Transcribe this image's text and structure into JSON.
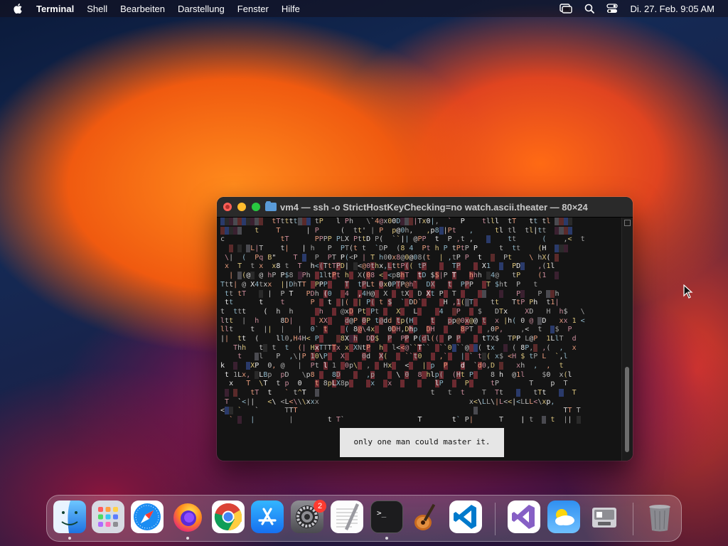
{
  "menubar": {
    "app_name": "Terminal",
    "menus": [
      "Shell",
      "Bearbeiten",
      "Darstellung",
      "Fenster",
      "Hilfe"
    ],
    "clock": "Di. 27. Feb.  9:05 AM"
  },
  "terminal": {
    "title": "vm4 — ssh -o StrictHostKeyChecking=no watch.ascii.theater — 80×24",
    "subtitle": "only one man could master it.",
    "ascii_lines": [
      "▒▒▒▒▒▒▒▒▒▒  tTtttt▒▒▒ tP   l Ph   \\`4@x00D▒▒▒|Tx0|,  `  P    tlll  tT   tt tl ▒▒▒▒",
      "▒▒▒▒▒   t    T      | P     (  tt' | P  p@0h,   ,p8▒|Pt   ,     tl tl  tl|tt  ▒▒▒▒",
      "c             tT      PPPP PLX PttD P(  ``|| @PP  t  P ,t ,   ▒    tt      (    ,<  t",
      "  ▒ ▒ ▒L|T    t|   | h   P  PT(t t  `DP  (8 4  Pt h P tPtP P     t  tt    (H  ▒▒▒",
      " \\|  (  Pq B\"    T ▒  P  PT P(<P | T h00x8@0@08(t  | ,tP P  t  ▒  Pt    \\ hX( ▒",
      " x  T  t x  x8 t  T  h<(TtTPD| ▒<@0thx,LttP(( tP      TP     X1  ▒  PD▒   ,(1l",
      "  | ▒(@▒ @ hP P$8 ▒Ph  1ltPt h  X(08 < <p8hT  tD $$|P T   hhh ▒4@   tP    (1  ▒",
      "Ttt| @ X4txx  ||DhTT  PPP    T  tPLt 0x0PTP@h`  DX   t  PPP   T $ht  P   t",
      " tt tT   ▒ |  P T   PDh (0   4  ,4H@  X   tX  D Xt P  T      ▒   ▒   P▒   P ▒▒h",
      " tt      t    t      P   t  |(  | P( t $  ` DD`     H ,1(▒T    tt   TtP Ph  t1|",
      "t  ttt    (  h  h      h    @xD Pt Pt    X   L     4  ▒P    $   DTx    XD   H  h$   \\",
      "ltt  |  h     8D|      XX    d@P 0P t@dd tp(H    t   pp@0x@@ t  x |h( 0 @ ▒D   xx 1 <",
      "llt    t  ||  |   |  0` t    ( 8@\\4x   0DH,Dhp  DH      8PT   ,0P,    ,<  t  ▒$  P",
      "||  tt  (    ll0,H4H< P    ▒8X▒h  DD$  P  PP P(dl((  P P     tTX$  TPP L@P  1LlT  d",
      "   Thh   t▒ t  t  (| HxTTTTx x XNtP  h  l<<@``T``  ``0▒``@ ▒( tx  ▒ ( 8P,▒ ,(  ,  x",
      "    t   ▒l   P  ,\\|P 10\\P   X    0d  X(    ``t0    ,`   | ` t▒( x$ <H $ tP L  `,l",
      "k  ▒  ▒XP  0, @   |  Pt l 1  0p\\  ,   Hx   <   | p  P   d  `d0,D ▒   xh  ,  ,  t",
      " t 1Lx, ▒LBp  pD   \\p8    8D      ,p     \\ 0  8 hlp(  (Ht P    8 h  @1l    $0  x(l",
      "  x   T  \\T  t p  0   t 8pLX8p     x   x          lP     P     tP       T    p  T",
      " ▒ ▒   tT  t   ` t^T  ▒                          t   t  t    T  Tt   ▒   tTt   ▒  T",
      " T  `<||   <\\ <L<\\\\\\xxx                                   x<\\LL\\|L<<|<LLL<\\xp,   ",
      "<▒▒ `   `      TTT                                         ▒                    TT T",
      "  ` ▒  |        |        t T`                 T       t` P|      T    | t  ▒ t  || ▒"
    ]
  },
  "dock": {
    "items": [
      {
        "name": "Finder",
        "icon": "finder-icon",
        "running": true
      },
      {
        "name": "Launchpad",
        "icon": "launchpad-icon",
        "running": false
      },
      {
        "name": "Safari",
        "icon": "safari-icon",
        "running": false
      },
      {
        "name": "Firefox",
        "icon": "firefox-icon",
        "running": true
      },
      {
        "name": "Chrome",
        "icon": "chrome-icon",
        "running": false
      },
      {
        "name": "App Store",
        "icon": "app-store-icon",
        "running": false
      },
      {
        "name": "Systemeinstellungen",
        "icon": "system-settings-icon",
        "running": false,
        "badge": "2"
      },
      {
        "name": "TextEdit",
        "icon": "textedit-icon",
        "running": false
      },
      {
        "name": "Terminal",
        "icon": "terminal-icon",
        "running": true
      },
      {
        "name": "GarageBand",
        "icon": "garageband-icon",
        "running": false
      },
      {
        "name": "Visual Studio Code",
        "icon": "vscode-icon",
        "running": false
      },
      {
        "name": "Visual Studio",
        "icon": "visual-studio-icon",
        "running": false
      },
      {
        "name": "Wetter",
        "icon": "weather-icon",
        "running": false
      },
      {
        "name": "Boot Camp",
        "icon": "bootcamp-icon",
        "running": false
      },
      {
        "name": "Papierkorb",
        "icon": "trash-icon",
        "running": false
      }
    ]
  }
}
